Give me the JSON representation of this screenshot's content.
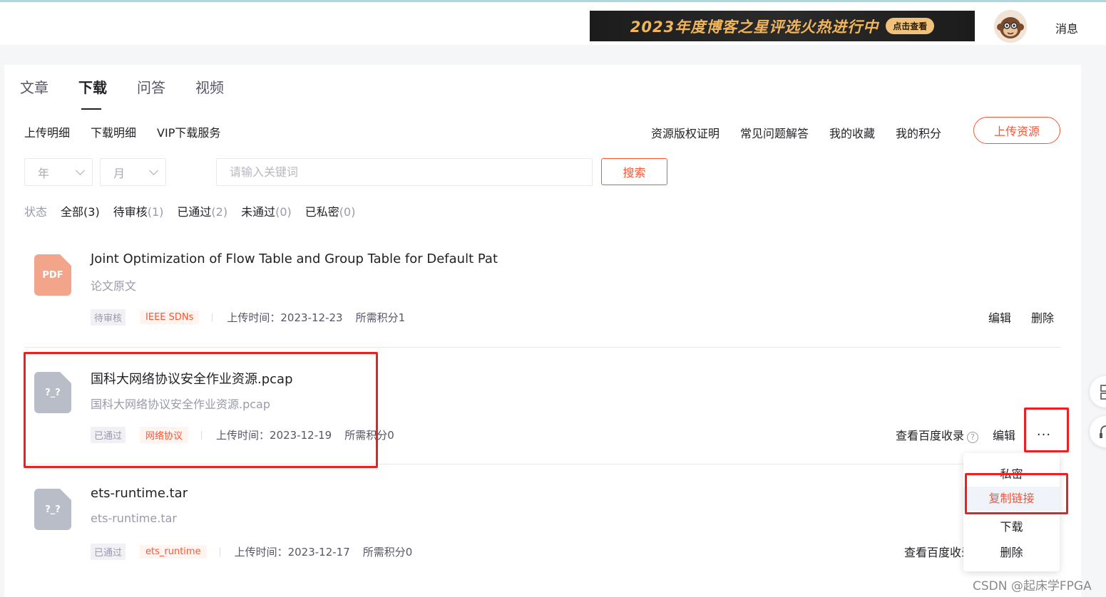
{
  "header": {
    "banner_text": "2023年度博客之星评选火热进行中",
    "banner_button": "点击查看",
    "avatar_icon": "monkey-avatar",
    "messages_label": "消息"
  },
  "tabs": [
    {
      "label": "文章",
      "active": false
    },
    {
      "label": "下载",
      "active": true
    },
    {
      "label": "问答",
      "active": false
    },
    {
      "label": "视频",
      "active": false
    }
  ],
  "subnav_left": [
    "上传明细",
    "下载明细",
    "VIP下载服务"
  ],
  "subnav_right": [
    "资源版权证明",
    "常见问题解答",
    "我的收藏",
    "我的积分"
  ],
  "upload_button": "上传资源",
  "filters": {
    "year_placeholder": "年",
    "month_placeholder": "月",
    "search_placeholder": "请输入关键词",
    "search_button": "搜索"
  },
  "status": {
    "label": "状态",
    "items": [
      {
        "name": "全部",
        "count": "(3)"
      },
      {
        "name": "待审核",
        "count": "(1)"
      },
      {
        "name": "已通过",
        "count": "(2)"
      },
      {
        "name": "未通过",
        "count": "(0)"
      },
      {
        "name": "已私密",
        "count": "(0)"
      }
    ]
  },
  "resources": [
    {
      "icon_label": "PDF",
      "title": "Joint Optimization of Flow Table and Group Table for Default Pat",
      "desc": "论文原文",
      "status_tag": "待审核",
      "category_tag": "IEEE SDNs",
      "upload_time": "上传时间：2023-12-23",
      "points": "所需积分1",
      "actions": [
        "编辑",
        "删除"
      ]
    },
    {
      "icon_label": "?_?",
      "title": "国科大网络协议安全作业资源.pcap",
      "desc": "国科大网络协议安全作业资源.pcap",
      "status_tag": "已通过",
      "category_tag": "网络协议",
      "upload_time": "上传时间：2023-12-19",
      "points": "所需积分0",
      "actions": [
        "查看百度收录",
        "编辑",
        "···"
      ],
      "help_icon": "?"
    },
    {
      "icon_label": "?_?",
      "title": "ets-runtime.tar",
      "desc": "ets-runtime.tar",
      "status_tag": "已通过",
      "category_tag": "ets_runtime",
      "upload_time": "上传时间：2023-12-17",
      "points": "所需积分0",
      "actions": [
        "查看百度收录"
      ]
    }
  ],
  "dropdown": {
    "items": [
      "私密",
      "复制链接",
      "下载",
      "删除"
    ],
    "hovered": "复制链接"
  },
  "colors": {
    "accent": "#fc5531",
    "highlight_box": "#f01e1e"
  },
  "watermark": "CSDN @起床学FPGA"
}
